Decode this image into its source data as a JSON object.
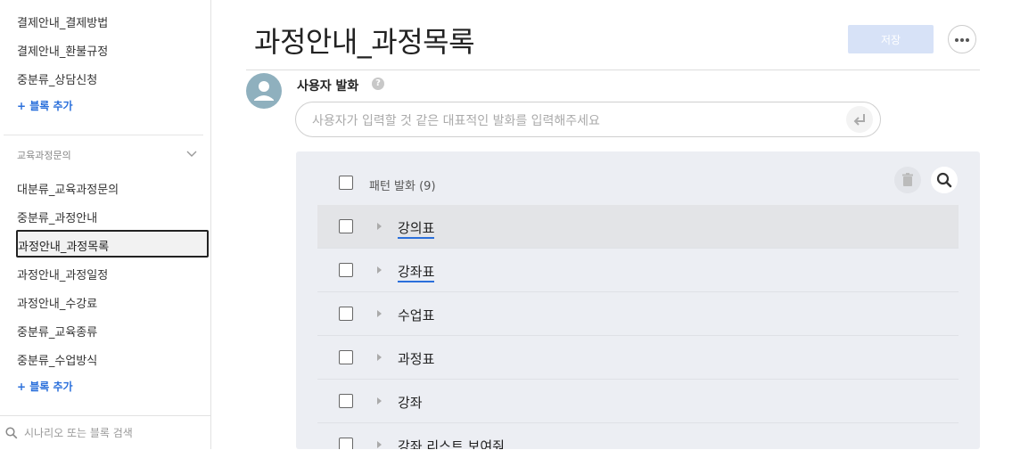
{
  "sidebar": {
    "items_top": [
      "결제안내_결제방법",
      "결제안내_환불규정",
      "중분류_상담신청"
    ],
    "add_block_label": "+ 블록 추가",
    "group_title": "교육과정문의",
    "items_group": [
      "대분류_교육과정문의",
      "중분류_과정안내",
      "과정안내_과정목록",
      "과정안내_과정일정",
      "과정안내_수강료",
      "중분류_교육종류",
      "중분류_수업방식"
    ],
    "selected_item": "과정안내_과정목록",
    "search_placeholder": "시나리오 또는 블록 검색"
  },
  "main": {
    "title": "과정안내_과정목록",
    "save_label": "저장",
    "user_utterance_label": "사용자 발화",
    "utterance_placeholder": "사용자가 입력할 것 같은 대표적인 발화를 입력해주세요",
    "pattern_header": "패턴 발화 (9)",
    "patterns": [
      "강의표",
      "강좌표",
      "수업표",
      "과정표",
      "강좌",
      "강좌 리스트 보여줘"
    ]
  },
  "colors": {
    "accent": "#2a6fdb",
    "save_disabled": "#d7e2f7",
    "panel_bg": "#eceef3",
    "avatar_bg": "#8fb0be"
  },
  "icons": [
    "chevron-down-icon",
    "search-icon",
    "more-icon",
    "help-icon",
    "user-avatar-icon",
    "enter-icon",
    "trash-icon",
    "caret-right-icon"
  ]
}
